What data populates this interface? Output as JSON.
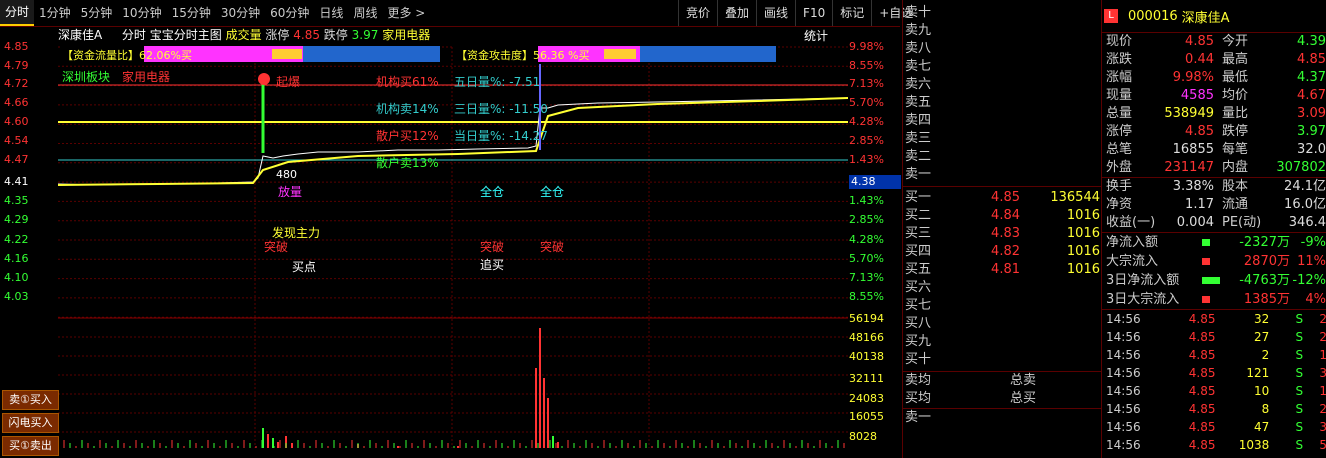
{
  "tabs": [
    "分时",
    "1分钟",
    "5分钟",
    "10分钟",
    "15分钟",
    "30分钟",
    "60分钟",
    "日线",
    "周线",
    "更多 >"
  ],
  "tools": [
    "竞价",
    "叠加",
    "画线",
    "F10",
    "标记",
    "+自选"
  ],
  "info": {
    "name": "深康佳A",
    "mode": "分时",
    "title": "宝宝分时主图",
    "vol_label": "成交量",
    "zt_label": "涨停",
    "zt_val": "4.85",
    "dt_label": "跌停",
    "dt_val": "3.97",
    "industry": "家用电器",
    "stat": "统计"
  },
  "left_axis": [
    "4.85",
    "4.79",
    "4.72",
    "4.66",
    "4.60",
    "4.54",
    "4.47",
    "4.41",
    "4.35",
    "4.29",
    "4.22",
    "4.16",
    "4.10",
    "4.03"
  ],
  "right_axis_pct": [
    "9.98%",
    "8.55%",
    "7.13%",
    "5.70%",
    "4.28%",
    "2.85%",
    "1.43%",
    "4.38",
    "1.43%",
    "2.85%",
    "4.28%",
    "5.70%",
    "7.13%",
    "8.55%"
  ],
  "vol_axis": [
    "56194",
    "48166",
    "40138",
    "32111",
    "24083",
    "16055",
    "8028"
  ],
  "annotations": {
    "flow_ratio": "【资金流量比】62.06%买",
    "attack": "【资金攻击度】56.36 %买",
    "sector": "深圳板块",
    "sector_ind": "家用电器",
    "qibao": "起爆",
    "jgm": "机构买61%",
    "jgs": "机构卖14%",
    "shm": "散户买12%",
    "shs": "散户卖13%",
    "five": "五日量%: -7.51",
    "three": "三日量%: -11.50",
    "today": "当日量%: -14.27",
    "fangliang": "放量",
    "faxian": "发现主力",
    "tupo1": "突破",
    "maidian": "买点",
    "quancang1": "全仓",
    "tupo2": "突破",
    "zhuimai": "追买",
    "quancang2": "全仓",
    "tupo3": "突破",
    "n480": "480"
  },
  "sidebuttons": [
    "卖①买入",
    "闪电买入",
    "买①卖出"
  ],
  "asks": [
    "卖十",
    "卖九",
    "卖八",
    "卖七",
    "卖六",
    "卖五",
    "卖四",
    "卖三",
    "卖二",
    "卖一"
  ],
  "bids": [
    {
      "n": "买一",
      "p": "4.85",
      "v": "136544"
    },
    {
      "n": "买二",
      "p": "4.84",
      "v": "1016"
    },
    {
      "n": "买三",
      "p": "4.83",
      "v": "1016"
    },
    {
      "n": "买四",
      "p": "4.82",
      "v": "1016"
    },
    {
      "n": "买五",
      "p": "4.81",
      "v": "1016"
    },
    {
      "n": "买六",
      "p": "",
      "v": ""
    },
    {
      "n": "买七",
      "p": "",
      "v": ""
    },
    {
      "n": "买八",
      "p": "",
      "v": ""
    },
    {
      "n": "买九",
      "p": "",
      "v": ""
    },
    {
      "n": "买十",
      "p": "",
      "v": ""
    }
  ],
  "avg": {
    "sell_avg": "卖均",
    "total_sell": "总卖",
    "buy_avg": "买均",
    "total_buy": "总买",
    "sell1": "卖一"
  },
  "stock": {
    "code": "000016",
    "name": "深康佳A"
  },
  "quotes": [
    {
      "k": "现价",
      "v": "4.85",
      "c": "#ff3333",
      "k2": "今开",
      "v2": "4.39",
      "c2": "#33ff33"
    },
    {
      "k": "涨跌",
      "v": "0.44",
      "c": "#ff3333",
      "k2": "最高",
      "v2": "4.85",
      "c2": "#ff3333"
    },
    {
      "k": "涨幅",
      "v": "9.98%",
      "c": "#ff3333",
      "k2": "最低",
      "v2": "4.37",
      "c2": "#33ff33"
    },
    {
      "k": "现量",
      "v": "4585",
      "c": "#ff33ff",
      "k2": "均价",
      "v2": "4.67",
      "c2": "#ff3333"
    },
    {
      "k": "总量",
      "v": "538949",
      "c": "#ffff33",
      "k2": "量比",
      "v2": "3.09",
      "c2": "#ff3333"
    },
    {
      "k": "涨停",
      "v": "4.85",
      "c": "#ff3333",
      "k2": "跌停",
      "v2": "3.97",
      "c2": "#33ff33"
    },
    {
      "k": "总笔",
      "v": "16855",
      "c": "#dddddd",
      "k2": "每笔",
      "v2": "32.0",
      "c2": "#dddddd"
    },
    {
      "k": "外盘",
      "v": "231147",
      "c": "#ff3333",
      "k2": "内盘",
      "v2": "307802",
      "c2": "#33ff33"
    }
  ],
  "quotes2": [
    {
      "k": "换手",
      "v": "3.38%",
      "k2": "股本",
      "v2": "24.1亿"
    },
    {
      "k": "净资",
      "v": "1.17",
      "k2": "流通",
      "v2": "16.0亿"
    },
    {
      "k": "收益(一)",
      "v": "0.004",
      "k2": "PE(动)",
      "v2": "346.4"
    }
  ],
  "flows": [
    {
      "k": "净流入额",
      "v": "-2327万",
      "p": "-9%",
      "c": "#33ff33"
    },
    {
      "k": "大宗流入",
      "v": "2870万",
      "p": "11%",
      "c": "#ff3333"
    },
    {
      "k": "3日净流入额",
      "v": "-4763万",
      "p": "-12%",
      "c": "#33ff33"
    },
    {
      "k": "3日大宗流入",
      "v": "1385万",
      "p": "4%",
      "c": "#ff3333"
    }
  ],
  "ticks": [
    {
      "t": "14:56",
      "p": "4.85",
      "v": "32",
      "s": "S",
      "n": "2"
    },
    {
      "t": "14:56",
      "p": "4.85",
      "v": "27",
      "s": "S",
      "n": "2"
    },
    {
      "t": "14:56",
      "p": "4.85",
      "v": "2",
      "s": "S",
      "n": "1"
    },
    {
      "t": "14:56",
      "p": "4.85",
      "v": "121",
      "s": "S",
      "n": "3"
    },
    {
      "t": "14:56",
      "p": "4.85",
      "v": "10",
      "s": "S",
      "n": "1"
    },
    {
      "t": "14:56",
      "p": "4.85",
      "v": "8",
      "s": "S",
      "n": "2"
    },
    {
      "t": "14:56",
      "p": "4.85",
      "v": "47",
      "s": "S",
      "n": "3"
    },
    {
      "t": "14:56",
      "p": "4.85",
      "v": "1038",
      "s": "S",
      "n": "5"
    }
  ],
  "colors": {
    "red": "#ff3333",
    "green": "#33ff33",
    "yellow": "#ffff33",
    "cyan": "#33cccc",
    "grid": "#6a0000"
  }
}
